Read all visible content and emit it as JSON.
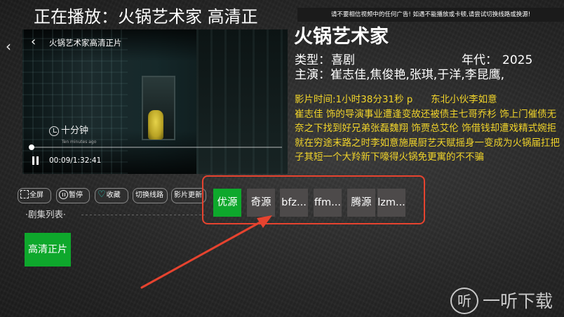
{
  "header": {
    "now_playing": "正在播放：火锅艺术家   高清正",
    "notice": "请不要相信视频中的任何广告! 如遇不能播放或卡顿,请尝试切换线路或换源!"
  },
  "player": {
    "title": "火锅艺术家高清正片",
    "watermark": "十分钟",
    "watermark_sub": "Ten minutes ago",
    "time": "00:09/1:32:41",
    "progress": 0.0016
  },
  "info": {
    "title": "火锅艺术家",
    "type_label": "类型：",
    "type_value": "喜剧",
    "year_label": "年代：",
    "year_value": "2025",
    "cast": "主演：崔志佳,焦俊艳,张琪,于洋,李昆鹰,",
    "duration_line": "影片时间:1小时38分31秒 p      东北小伙李如意",
    "description": "崔志佳 饰的导演事业遭逢变故还被债主七哥乔杉 饰上门催债无奈之下找到好兄弟张磊魏翔 饰贾总艾伦 饰借钱却遭戏精式婉拒就在穷途末路之时李如意施展厨艺天赋摇身一变成为火锅届扛把子其短一个大羚新下嚎得火锅免更寓的不不骗"
  },
  "controls": {
    "fullscreen": "全屏",
    "pause": "暂停",
    "favorite": "收藏",
    "switch_line": "切换线路",
    "update": "影片更新"
  },
  "episodes": {
    "title": "·剧集列表·",
    "items": [
      "高清正片"
    ]
  },
  "sources": [
    "优源",
    "奇源",
    "bfz...",
    "ffm...",
    "腾源",
    "lzm..."
  ],
  "colors": {
    "accent_green": "#0ea82c",
    "description_yellow": "#f1d42a",
    "annotation_red": "#e6432f"
  },
  "brand": {
    "logo_glyph": "听",
    "name": "一听下载"
  }
}
